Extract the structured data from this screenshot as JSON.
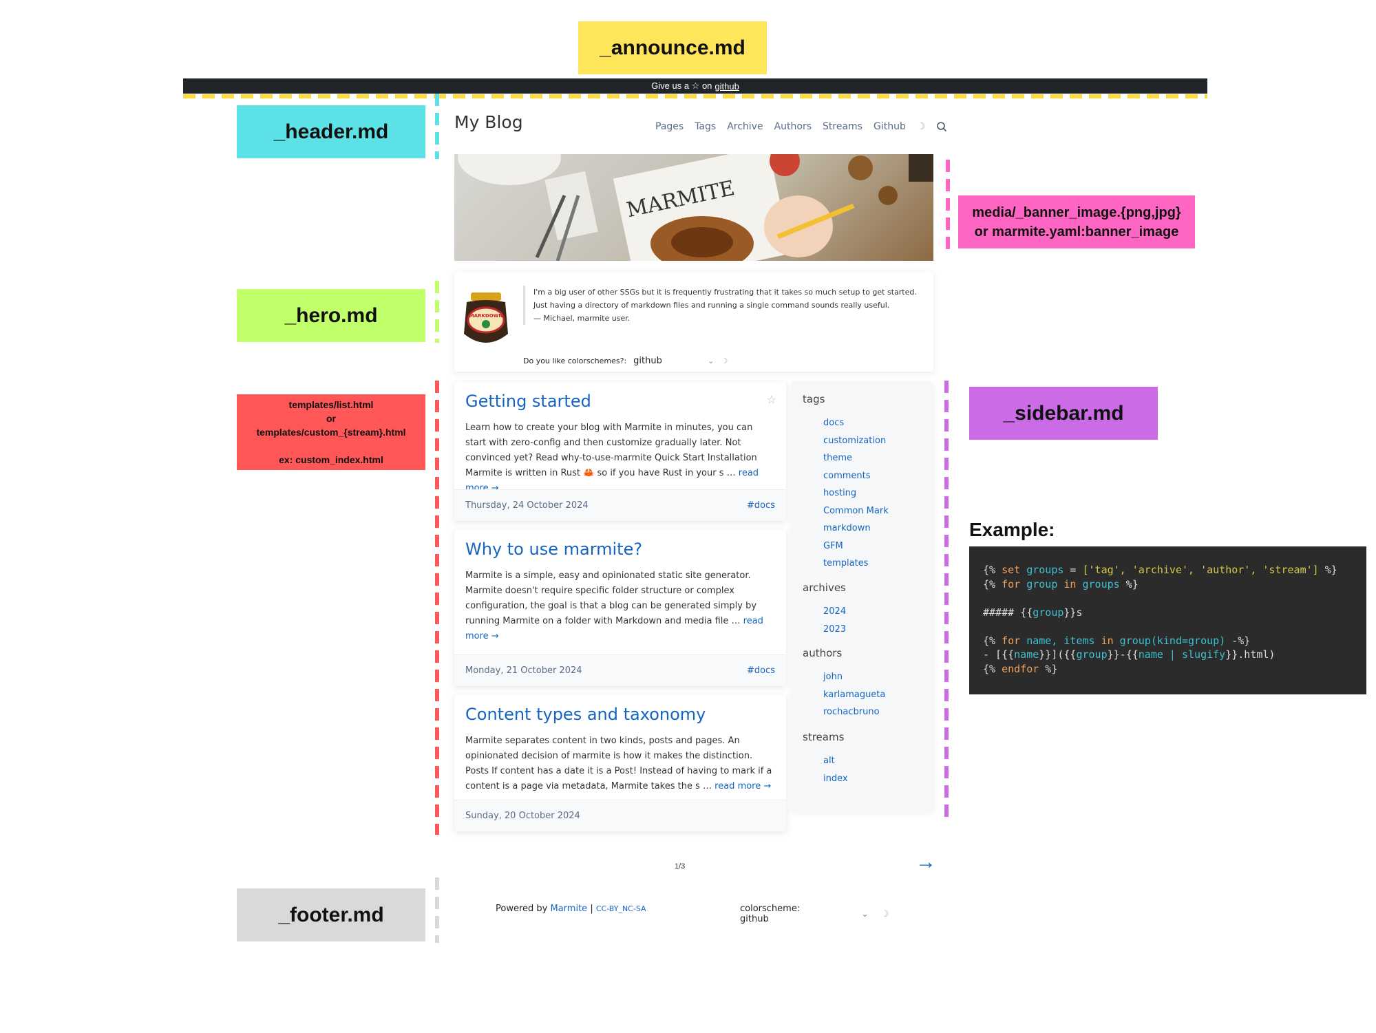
{
  "labels": {
    "announce": "_announce.md",
    "header": "_header.md",
    "banner_line1": "media/_banner_image.{png,jpg}",
    "banner_line2": "or marmite.yaml:banner_image",
    "hero": "_hero.md",
    "list_line1": "templates/list.html",
    "list_line2": "or",
    "list_line3": "templates/custom_{stream}.html",
    "list_line4": "ex: custom_index.html",
    "sidebar": "_sidebar.md",
    "footer": "_footer.md",
    "example": "Example:"
  },
  "colors": {
    "announce": "#ffe55a",
    "header": "#5ce1e6",
    "banner": "#ff66c4",
    "hero": "#c1ff6a",
    "list": "#ff5757",
    "sidebar": "#cb6ce6",
    "footer": "#d9d9d9",
    "link": "#1565c0"
  },
  "announce_bar": {
    "prefix": "Give us a ☆ on",
    "link": "github"
  },
  "header": {
    "title": "My Blog",
    "nav": [
      "Pages",
      "Tags",
      "Archive",
      "Authors",
      "Streams",
      "Github"
    ],
    "theme_toggle": "☽",
    "search_icon": "search-icon"
  },
  "banner": {
    "word": "MARMITE"
  },
  "hero": {
    "logo_text": "MARKDOWN",
    "quote_line1": "I'm a big user of other SSGs but it is frequently frustrating that it takes so much setup to get started.",
    "quote_line2": "Just having a directory of markdown files and running a single command sounds really useful.",
    "quote_line3": "— Michael, marmite user.",
    "select_label": "Do you like colorschemes?:",
    "select_value": "github",
    "chevron": "⌄",
    "moon": "☽"
  },
  "posts": [
    {
      "title": "Getting started",
      "excerpt": "Learn how to create your blog with Marmite in minutes, you can start with zero-config and then customize gradually later. Not convinced yet? Read why-to-use-marmite Quick Start Installation Marmite is written in Rust 🦀 so if you have Rust in your s …",
      "read_more": "read more →",
      "date": "Thursday, 24 October 2024",
      "tag": "#docs",
      "star": "☆"
    },
    {
      "title": "Why to use marmite?",
      "excerpt": "Marmite is a simple, easy and opinionated static site generator. Marmite doesn't require specific folder structure or complex configuration, the goal is that a blog can be generated simply by running Marmite on a folder with Markdown and media file …",
      "read_more": "read more →",
      "date": "Monday, 21 October 2024",
      "tag": "#docs"
    },
    {
      "title": "Content types and taxonomy",
      "excerpt": "Marmite separates content in two kinds, posts and pages. An opinionated decision of marmite is how it makes the distinction. Posts If content has a date it is a Post! Instead of having to mark if a content is a page via metadata, Marmite takes the s …",
      "read_more": "read more →",
      "date": "Sunday, 20 October 2024",
      "tag": ""
    }
  ],
  "sidebar": {
    "tags_head": "tags",
    "tags": [
      "docs",
      "customization",
      "theme",
      "comments",
      "hosting",
      "Common Mark",
      "markdown",
      "GFM",
      "templates"
    ],
    "archives_head": "archives",
    "archives": [
      "2024",
      "2023"
    ],
    "authors_head": "authors",
    "authors": [
      "john",
      "karlamagueta",
      "rochacbruno"
    ],
    "streams_head": "streams",
    "streams": [
      "alt",
      "index"
    ]
  },
  "pagination": {
    "page": "1/3",
    "next": "→"
  },
  "footer": {
    "powered": "Powered by",
    "marmite": "Marmite",
    "sep": "|",
    "license": "CC-BY_NC-SA",
    "scheme_label": "colorscheme: github",
    "chevron": "⌄",
    "moon": "☽"
  },
  "example_code": {
    "l1a": "{% ",
    "l1b": "set",
    "l1c": " groups",
    "l1d": " = ",
    "l1e": "['tag', 'archive', 'author', 'stream']",
    "l1f": " %}",
    "l2a": "{% ",
    "l2b": "for",
    "l2c": " group",
    "l2d": " in",
    "l2e": " groups",
    "l2f": " %}",
    "l3a": "##### {{",
    "l3b": "group",
    "l3c": "}}s",
    "l4a": "{% ",
    "l4b": "for",
    "l4c": " name, items",
    "l4d": " in",
    "l4e": " group(kind=group)",
    "l4f": " -%}",
    "l5a": "- [{{",
    "l5b": "name",
    "l5c": "}}]({{",
    "l5d": "group",
    "l5e": "}}-{{",
    "l5f": "name | slugify",
    "l5g": "}}.html)",
    "l6a": "{% ",
    "l6b": "endfor",
    "l6c": " %}"
  }
}
